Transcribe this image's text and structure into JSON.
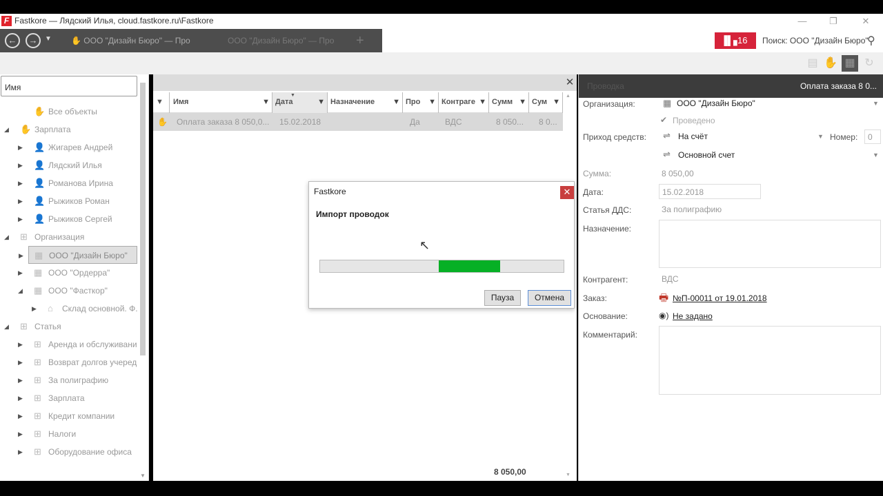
{
  "window": {
    "title": "Fastkore — Лядский Илья, cloud.fastkore.ru\\Fastkore",
    "logo_letter": "F"
  },
  "toolbar": {
    "tabs": [
      "ООО \"Дизайн Бюро\" — Про",
      "ООО \"Дизайн Бюро\" — Про"
    ],
    "add_tab": "+",
    "notification_count": "16",
    "search_text": "Поиск: ООО \"Дизайн Бюро\""
  },
  "tree": {
    "search_placeholder": "Имя",
    "items": [
      {
        "label": "Все объекты",
        "level": 1,
        "arrow": "",
        "icon": "hand-money-icon"
      },
      {
        "label": "Зарплата",
        "level": 0,
        "arrow": "◢",
        "icon": "hand-money-icon"
      },
      {
        "label": "Жигарев Андрей",
        "level": 1,
        "arrow": "▶",
        "icon": "person-icon"
      },
      {
        "label": "Лядский Илья",
        "level": 1,
        "arrow": "▶",
        "icon": "person-icon"
      },
      {
        "label": "Романова Ирина",
        "level": 1,
        "arrow": "▶",
        "icon": "person-icon"
      },
      {
        "label": "Рыжиков Роман",
        "level": 1,
        "arrow": "▶",
        "icon": "person-icon"
      },
      {
        "label": "Рыжиков Сергей",
        "level": 1,
        "arrow": "▶",
        "icon": "person-icon"
      },
      {
        "label": "Организация",
        "level": 0,
        "arrow": "◢",
        "icon": "org-chart-icon"
      },
      {
        "label": "ООО \"Дизайн Бюро\"",
        "level": 1,
        "arrow": "▶",
        "icon": "building-icon",
        "selected": true
      },
      {
        "label": "ООО \"Ордерра\"",
        "level": 1,
        "arrow": "▶",
        "icon": "building-icon"
      },
      {
        "label": "ООО \"Фасткор\"",
        "level": 1,
        "arrow": "◢",
        "icon": "building-icon"
      },
      {
        "label": "Склад основной. Ф.",
        "level": 2,
        "arrow": "▶",
        "icon": "warehouse-icon"
      },
      {
        "label": "Статья",
        "level": 0,
        "arrow": "◢",
        "icon": "grid-icon"
      },
      {
        "label": "Аренда и обслуживани",
        "level": 1,
        "arrow": "▶",
        "icon": "grid-icon"
      },
      {
        "label": "Возврат долгов учеред",
        "level": 1,
        "arrow": "▶",
        "icon": "grid-icon"
      },
      {
        "label": "За полиграфию",
        "level": 1,
        "arrow": "▶",
        "icon": "grid-icon"
      },
      {
        "label": "Зарплата",
        "level": 1,
        "arrow": "▶",
        "icon": "grid-icon"
      },
      {
        "label": "Кредит компании",
        "level": 1,
        "arrow": "▶",
        "icon": "grid-icon"
      },
      {
        "label": "Налоги",
        "level": 1,
        "arrow": "▶",
        "icon": "grid-icon"
      },
      {
        "label": "Оборудование офиса",
        "level": 1,
        "arrow": "▶",
        "icon": "grid-icon"
      }
    ]
  },
  "grid": {
    "columns": [
      "Имя",
      "Дата",
      "Назначение",
      "Про",
      "Контраге",
      "Сумм",
      "Сум"
    ],
    "sort_column": "Дата",
    "rows": [
      {
        "name": "Оплата заказа 8 050,0...",
        "date": "15.02.2018",
        "purpose": "",
        "posted": "Да",
        "counterparty": "ВДС",
        "sum1": "8 050...",
        "sum2": "8 0..."
      }
    ],
    "total": "8 050,00"
  },
  "dialog": {
    "title": "Fastkore",
    "heading": "Импорт проводок",
    "progress": {
      "start": 0.488,
      "end": 0.74
    },
    "pause_label": "Пауза",
    "cancel_label": "Отмена"
  },
  "detail": {
    "header_left": "Проводка",
    "header_right": "Оплата заказа 8 0...",
    "organization_label": "Организация:",
    "organization_value": "ООО \"Дизайн Бюро\"",
    "posted_label": "Проведено",
    "income_label": "Приход средств:",
    "income_value": "На счёт",
    "number_label": "Номер:",
    "number_value": "0",
    "account_value": "Основной счет",
    "sum_label": "Сумма:",
    "sum_value": "8 050,00",
    "date_label": "Дата:",
    "date_value": "15.02.2018",
    "dds_label": "Статья ДДС:",
    "dds_value": "За полиграфию",
    "purpose_label": "Назначение:",
    "counterparty_label": "Контрагент:",
    "counterparty_value": "ВДС",
    "order_label": "Заказ:",
    "order_value": "№П-00011 от 19.01.2018",
    "basis_label": "Основание:",
    "basis_value": "Не задано",
    "comment_label": "Комментарий:"
  },
  "colors": {
    "accent_red": "#d6233a",
    "progress_green": "#06b025",
    "dark_header": "#3c3c3c"
  }
}
